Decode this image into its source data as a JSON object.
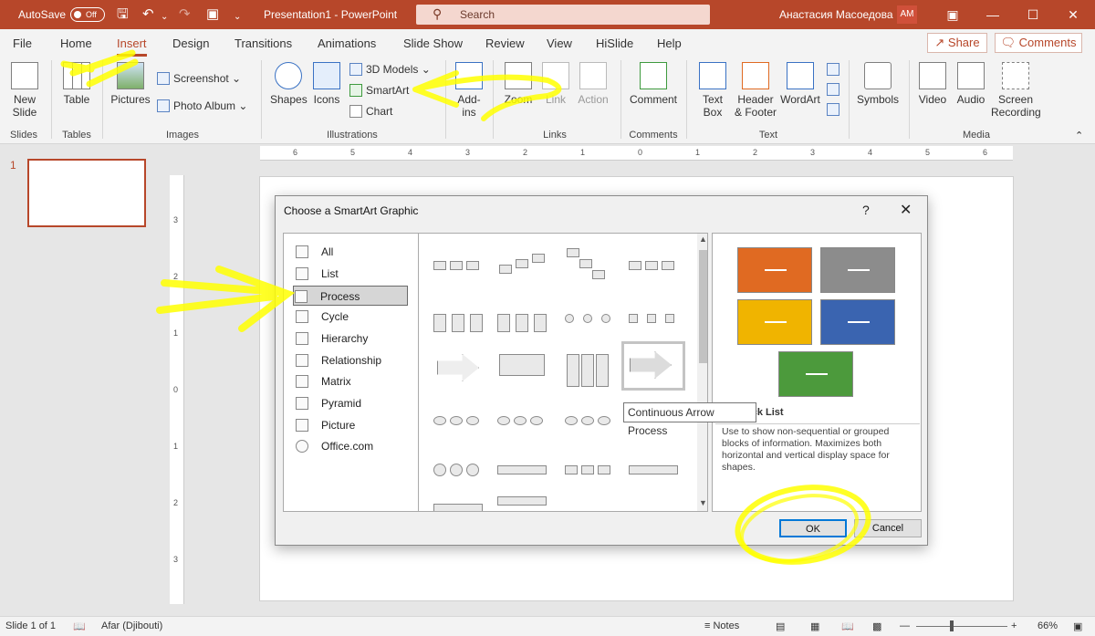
{
  "titlebar": {
    "autosave_label": "AutoSave",
    "autosave_state": "Off",
    "document_title": "Presentation1 - PowerPoint",
    "search_placeholder": "Search",
    "user_name": "Анастасия Масоедова",
    "user_initials": "AM"
  },
  "menu": {
    "tabs": [
      "File",
      "Home",
      "Insert",
      "Design",
      "Transitions",
      "Animations",
      "Slide Show",
      "Review",
      "View",
      "HiSlide",
      "Help"
    ],
    "active_tab": "Insert",
    "share_label": "Share",
    "comments_label": "Comments"
  },
  "ribbon": {
    "new_slide": "New Slide",
    "table": "Table",
    "pictures": "Pictures",
    "screenshot": "Screenshot",
    "photo_album": "Photo Album",
    "shapes": "Shapes",
    "icons": "Icons",
    "models_3d": "3D Models",
    "smartart": "SmartArt",
    "chart": "Chart",
    "addins": "Add-ins",
    "zoom": "Zoom",
    "link": "Link",
    "action": "Action",
    "comment": "Comment",
    "text_box": "Text Box",
    "header_footer": "Header & Footer",
    "wordart": "WordArt",
    "symbols": "Symbols",
    "video": "Video",
    "audio": "Audio",
    "screen_recording": "Screen Recording",
    "groups": {
      "slides": "Slides",
      "tables": "Tables",
      "images": "Images",
      "illustrations": "Illustrations",
      "links": "Links",
      "comments": "Comments",
      "text": "Text",
      "media": "Media"
    }
  },
  "thumbnails": {
    "slide_number": "1"
  },
  "rulers": {
    "h": [
      "6",
      "5",
      "4",
      "3",
      "2",
      "1",
      "0",
      "1",
      "2",
      "3",
      "4",
      "5",
      "6"
    ],
    "v": [
      "3",
      "2",
      "1",
      "0",
      "1",
      "2",
      "3"
    ]
  },
  "dialog": {
    "title": "Choose a SmartArt Graphic",
    "help": "?",
    "categories": [
      "All",
      "List",
      "Process",
      "Cycle",
      "Hierarchy",
      "Relationship",
      "Matrix",
      "Pyramid",
      "Picture",
      "Office.com"
    ],
    "selected_category": "Process",
    "tooltip": "Continuous Arrow Process",
    "preview_title": "ock List",
    "preview_description": "Use to show non-sequential or grouped blocks of information. Maximizes both horizontal and vertical display space for shapes.",
    "ok_label": "OK",
    "cancel_label": "Cancel",
    "preview_colors": [
      "#e06a22",
      "#8c8c8c",
      "#f0b400",
      "#3a64b0",
      "#4c9a3c"
    ]
  },
  "status": {
    "slide_info": "Slide 1 of 1",
    "language": "Afar (Djibouti)",
    "notes": "Notes",
    "zoom_level": "66%"
  },
  "colors": {
    "accent": "#b7472a",
    "highlighter": "#ffff00"
  }
}
